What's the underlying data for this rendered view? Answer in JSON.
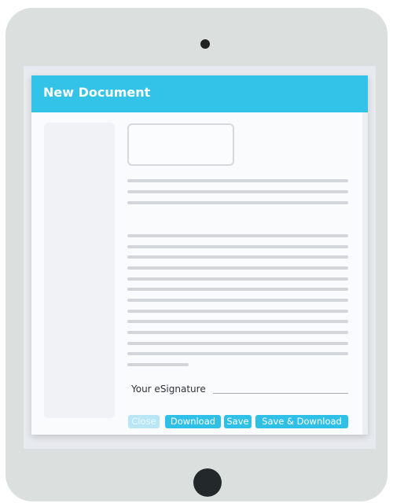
{
  "window": {
    "title": "New Document"
  },
  "signature": {
    "label": "Your eSignature"
  },
  "buttons": {
    "close": "Close",
    "download": "Download",
    "save": "Save",
    "save_download": "Save & Download"
  },
  "colors": {
    "accent": "#34c3e8",
    "button": "#2ec0e6",
    "button_disabled": "#b8e6f4",
    "tablet_frame": "#dbe0df"
  }
}
